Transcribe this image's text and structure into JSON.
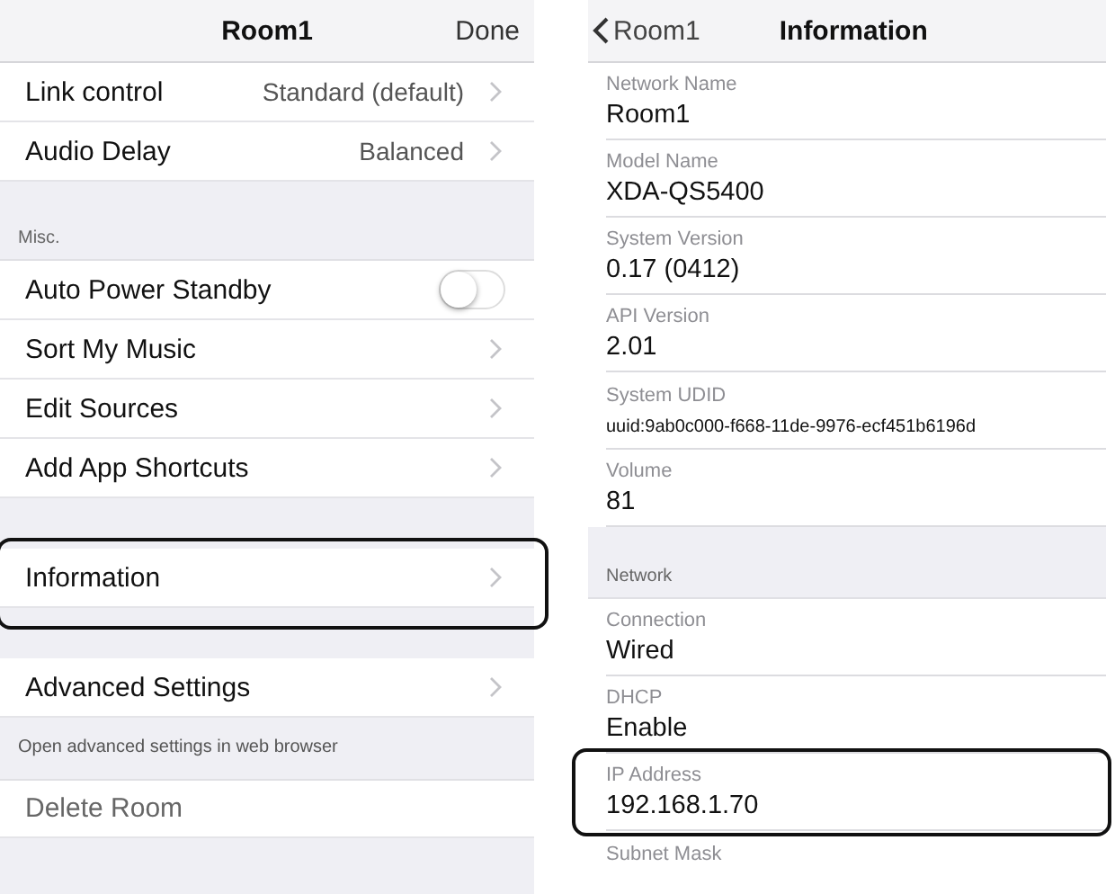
{
  "settings_panel": {
    "title": "Room1",
    "done_button": "Done",
    "items": [
      {
        "kind": "link",
        "label": "Link control",
        "value": "Standard (default)",
        "highlighted": false
      },
      {
        "kind": "link",
        "label": "Audio Delay",
        "value": "Balanced",
        "highlighted": false
      },
      {
        "kind": "section",
        "text": "Misc."
      },
      {
        "kind": "toggle",
        "label": "Auto Power Standby",
        "on": false,
        "highlighted": false
      },
      {
        "kind": "link",
        "label": "Sort My Music",
        "highlighted": false
      },
      {
        "kind": "link",
        "label": "Edit Sources",
        "highlighted": false
      },
      {
        "kind": "link",
        "label": "Add App Shortcuts",
        "highlighted": false
      },
      {
        "kind": "spacer"
      },
      {
        "kind": "link",
        "label": "Information",
        "highlighted": true
      },
      {
        "kind": "spacer"
      },
      {
        "kind": "link",
        "label": "Advanced Settings",
        "highlighted": false
      },
      {
        "kind": "footnote",
        "text": "Open advanced settings in web browser"
      },
      {
        "kind": "action",
        "label": "Delete Room",
        "highlighted": false
      },
      {
        "kind": "spacer"
      }
    ]
  },
  "info_panel": {
    "back_button": "Room1",
    "title": "Information",
    "items": [
      {
        "kind": "field",
        "label": "Network Name",
        "value": "Room1",
        "highlighted": false
      },
      {
        "kind": "field",
        "label": "Model Name",
        "value": "XDA-QS5400",
        "highlighted": false
      },
      {
        "kind": "field",
        "label": "System Version",
        "value": "0.17 (0412)",
        "highlighted": false
      },
      {
        "kind": "field",
        "label": "API Version",
        "value": "2.01",
        "highlighted": false
      },
      {
        "kind": "field",
        "label": "System UDID",
        "value": "uuid:9ab0c000-f668-11de-9976-ecf451b6196d",
        "highlighted": false
      },
      {
        "kind": "field",
        "label": "Volume",
        "value": "81",
        "highlighted": false
      },
      {
        "kind": "section",
        "text": "Network"
      },
      {
        "kind": "field",
        "label": "Connection",
        "value": "Wired",
        "highlighted": false
      },
      {
        "kind": "field",
        "label": "DHCP",
        "value": "Enable",
        "highlighted": false
      },
      {
        "kind": "field",
        "label": "IP Address",
        "value": "192.168.1.70",
        "highlighted": true
      },
      {
        "kind": "field",
        "label": "Subnet Mask",
        "highlighted": false
      }
    ]
  }
}
